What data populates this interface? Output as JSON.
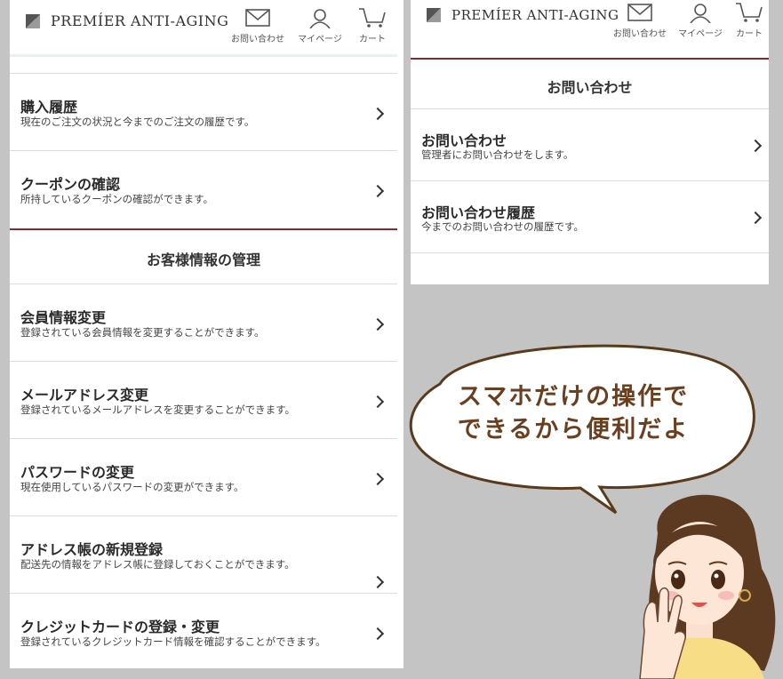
{
  "brand": {
    "logo_text": "PREMÍER ANTI-AGING"
  },
  "header_nav": {
    "contact_label": "お問い合わせ",
    "mypage_label": "マイページ",
    "cart_label": "カート"
  },
  "left": {
    "items_top": [
      {
        "title": "購入履歴",
        "desc": "現在のご注文の状況と今までのご注文の履歴です。"
      },
      {
        "title": "クーポンの確認",
        "desc": "所持しているクーポンの確認ができます。"
      }
    ],
    "section_title": "お客様情報の管理",
    "items_account": [
      {
        "title": "会員情報変更",
        "desc": "登録されている会員情報を変更することができます。"
      },
      {
        "title": "メールアドレス変更",
        "desc": "登録されているメールアドレスを変更することができます。"
      },
      {
        "title": "パスワードの変更",
        "desc": "現在使用しているパスワードの変更ができます。"
      },
      {
        "title": "アドレス帳の新規登録",
        "desc": "配送先の情報をアドレス帳に登録しておくことができます。"
      },
      {
        "title": "クレジットカードの登録・変更",
        "desc": "登録されているクレジットカード情報を確認することができます。"
      }
    ]
  },
  "right": {
    "section_title": "お問い合わせ",
    "items": [
      {
        "title": "お問い合わせ",
        "desc": "管理者にお問い合わせをします。"
      },
      {
        "title": "お問い合わせ履歴",
        "desc": "今までのお問い合わせの履歴です。"
      }
    ]
  },
  "bubble": {
    "line1": "スマホだけの操作で",
    "line2": "できるから便利だよ"
  },
  "colors": {
    "accent_red": "#8b2a2a",
    "bubble_text": "#6b3e20",
    "bubble_stroke": "#5a3a1a",
    "background": "#c4c4c4"
  }
}
